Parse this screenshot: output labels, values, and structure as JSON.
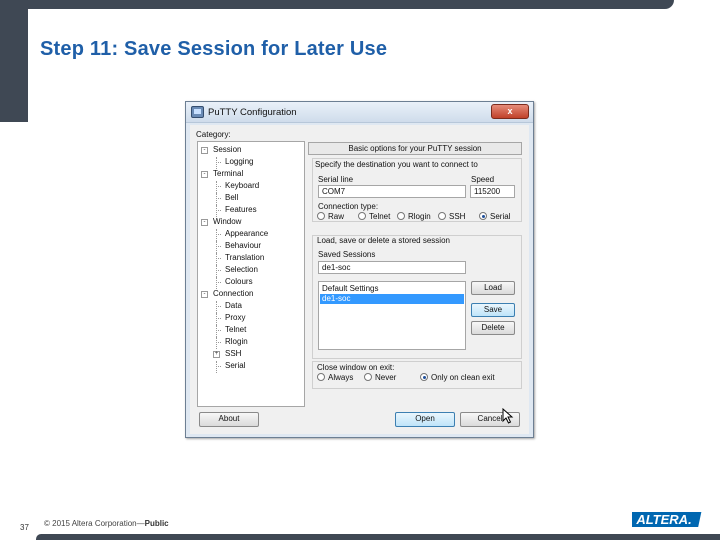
{
  "slide": {
    "title": "Step 11: Save Session for Later Use",
    "page_number": "37",
    "footer_copyright": "© 2015 Altera Corporation—",
    "footer_public": "Public",
    "logo_text": "ALTERA."
  },
  "window": {
    "title": "PuTTY Configuration",
    "close_label": "x"
  },
  "category": {
    "label": "Category:",
    "tree": [
      {
        "label": "Session",
        "level": 0,
        "expander": "-"
      },
      {
        "label": "Logging",
        "level": 1
      },
      {
        "label": "Terminal",
        "level": 0,
        "expander": "-"
      },
      {
        "label": "Keyboard",
        "level": 1
      },
      {
        "label": "Bell",
        "level": 1
      },
      {
        "label": "Features",
        "level": 1
      },
      {
        "label": "Window",
        "level": 0,
        "expander": "-"
      },
      {
        "label": "Appearance",
        "level": 1
      },
      {
        "label": "Behaviour",
        "level": 1
      },
      {
        "label": "Translation",
        "level": 1
      },
      {
        "label": "Selection",
        "level": 1
      },
      {
        "label": "Colours",
        "level": 1
      },
      {
        "label": "Connection",
        "level": 0,
        "expander": "-"
      },
      {
        "label": "Data",
        "level": 1
      },
      {
        "label": "Proxy",
        "level": 1
      },
      {
        "label": "Telnet",
        "level": 1
      },
      {
        "label": "Rlogin",
        "level": 1
      },
      {
        "label": "SSH",
        "level": 1,
        "expander": "+"
      },
      {
        "label": "Serial",
        "level": 1
      }
    ]
  },
  "session": {
    "header": "Basic options for your PuTTY session",
    "destination_label": "Specify the destination you want to connect to",
    "serial_line_label": "Serial line",
    "serial_line_value": "COM7",
    "speed_label": "Speed",
    "speed_value": "115200",
    "connection_type_label": "Connection type:",
    "connection_types": [
      {
        "label": "Raw",
        "selected": false
      },
      {
        "label": "Telnet",
        "selected": false
      },
      {
        "label": "Rlogin",
        "selected": false
      },
      {
        "label": "SSH",
        "selected": false
      },
      {
        "label": "Serial",
        "selected": true
      }
    ],
    "load_save_label": "Load, save or delete a stored session",
    "saved_sessions_label": "Saved Sessions",
    "saved_sessions_value": "de1-soc",
    "sessions_list": [
      {
        "label": "Default Settings",
        "selected": false
      },
      {
        "label": "de1-soc",
        "selected": true
      }
    ],
    "load_button": "Load",
    "save_button": "Save",
    "delete_button": "Delete",
    "close_window_label": "Close window on exit:",
    "close_options": [
      {
        "label": "Always",
        "selected": false
      },
      {
        "label": "Never",
        "selected": false
      },
      {
        "label": "Only on clean exit",
        "selected": true
      }
    ]
  },
  "bottom": {
    "about_button": "About",
    "open_button": "Open",
    "cancel_button": "Cancel"
  }
}
